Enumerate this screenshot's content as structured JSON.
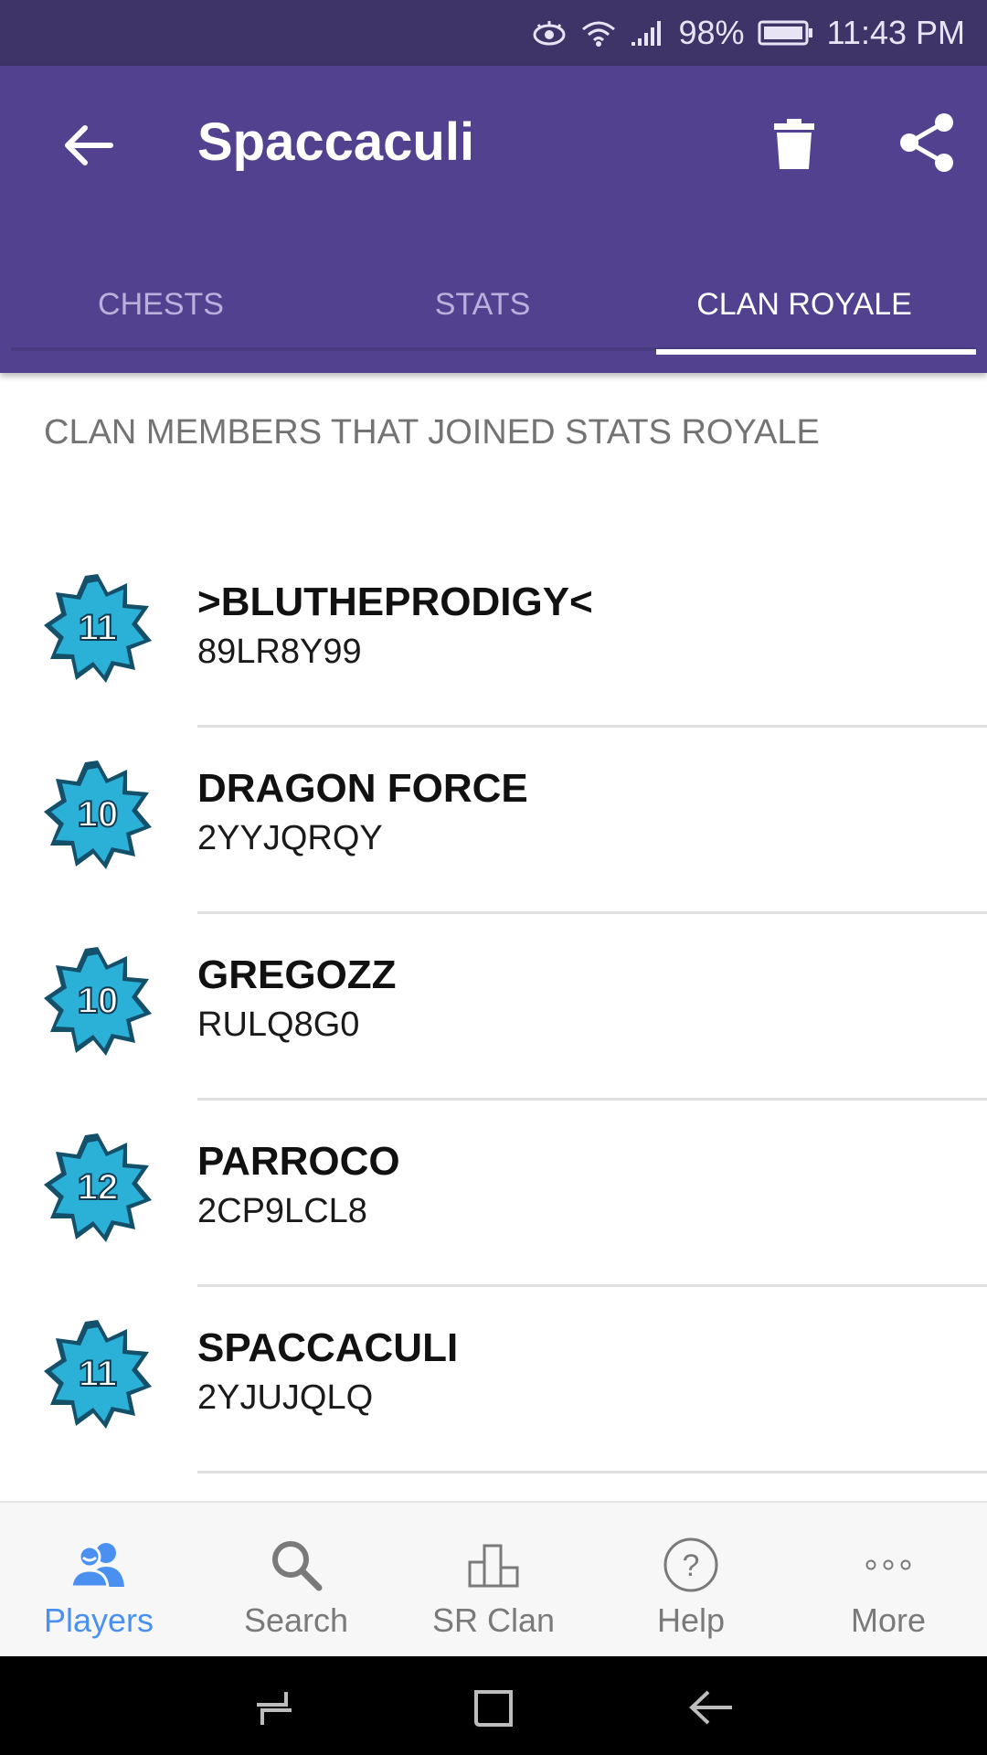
{
  "status_bar": {
    "battery": "98%",
    "time": "11:43 PM"
  },
  "app_bar": {
    "title": "Spaccaculi"
  },
  "tabs": [
    {
      "label": "CHESTS",
      "active": false
    },
    {
      "label": "STATS",
      "active": false
    },
    {
      "label": "CLAN ROYALE",
      "active": true
    }
  ],
  "section": {
    "header": "CLAN MEMBERS THAT JOINED STATS ROYALE"
  },
  "members": [
    {
      "level": "11",
      "name": ">BLUTHEPRODIGY<",
      "tag": "89LR8Y99"
    },
    {
      "level": "10",
      "name": "DRAGON FORCE",
      "tag": "2YYJQRQY"
    },
    {
      "level": "10",
      "name": "GREGOZZ",
      "tag": "RULQ8G0"
    },
    {
      "level": "12",
      "name": "PARROCO",
      "tag": "2CP9LCL8"
    },
    {
      "level": "11",
      "name": "SPACCACULI",
      "tag": "2YJUJQLQ"
    }
  ],
  "bottom_nav": [
    {
      "label": "Players",
      "icon": "players-icon",
      "active": true
    },
    {
      "label": "Search",
      "icon": "search-icon",
      "active": false
    },
    {
      "label": "SR Clan",
      "icon": "sr-clan-icon",
      "active": false
    },
    {
      "label": "Help",
      "icon": "help-icon",
      "active": false
    },
    {
      "label": "More",
      "icon": "more-icon",
      "active": false
    }
  ],
  "colors": {
    "app_bar": "#52418f",
    "status_bar": "#3e3468",
    "active_nav": "#4a90f0",
    "badge": "#1f8fb8"
  }
}
